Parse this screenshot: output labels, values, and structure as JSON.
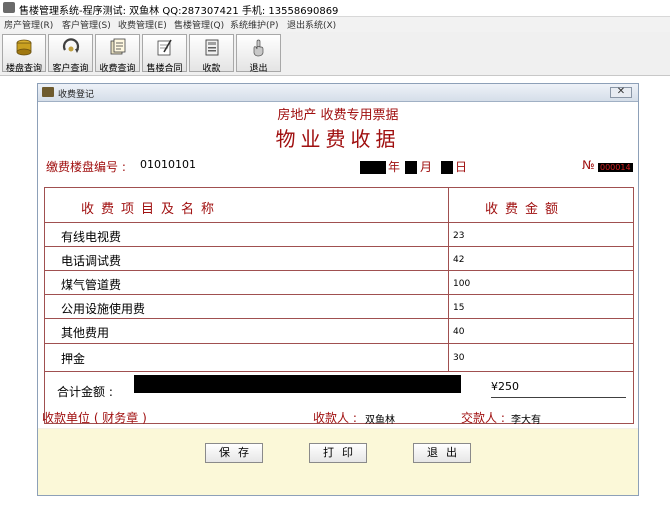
{
  "window": {
    "title": "售楼管理系统-程序测试: 双鱼林 QQ:287307421 手机: 13558690869"
  },
  "menu": [
    "房产管理(R)",
    "客户管理(S)",
    "收费管理(E)",
    "售楼管理(Q)",
    "系统维护(P)",
    "退出系统(X)"
  ],
  "toolbar": [
    {
      "label": "楼盘查询",
      "icon": "building-disk-icon"
    },
    {
      "label": "客户查询",
      "icon": "customer-query-icon"
    },
    {
      "label": "收费查询",
      "icon": "fee-query-icon"
    },
    {
      "label": "售楼合同",
      "icon": "contract-icon"
    },
    {
      "label": "收款",
      "icon": "payment-icon"
    },
    {
      "label": "退出",
      "icon": "exit-hand-icon"
    }
  ],
  "dialog": {
    "title": "收费登记",
    "close_glyph": "✕"
  },
  "receipt": {
    "heading1": "房地产 收费专用票据",
    "heading2": "物业费收据",
    "building_label": "缴费楼盘编号 :",
    "building_value": "01010101",
    "year_char": "年",
    "month_char": "月",
    "day_char": "日",
    "no_label": "№",
    "no_value": "000014",
    "col_item": "收费项目及名称",
    "col_amount": "收费金额",
    "items": [
      {
        "name": "有线电视费",
        "amount": "23"
      },
      {
        "name": "电话调试费",
        "amount": "42"
      },
      {
        "name": "煤气管道费",
        "amount": "100"
      },
      {
        "name": "公用设施使用费",
        "amount": "15"
      },
      {
        "name": "其他费用",
        "amount": "40"
      },
      {
        "name": "押金",
        "amount": "30"
      }
    ],
    "total_label": "合计金额 :",
    "total_value": "¥250",
    "payee_unit": "收款单位 ( 财务章 )",
    "receiver_label": "收款人 :",
    "receiver_value": "双鱼林",
    "payer_label": "交款人 :",
    "payer_value": "李大有"
  },
  "buttons": {
    "save": "保存",
    "print": "打印",
    "exit": "退出"
  },
  "colors": {
    "accent_red": "#a01010",
    "button_bar": "#fbf8d8"
  }
}
